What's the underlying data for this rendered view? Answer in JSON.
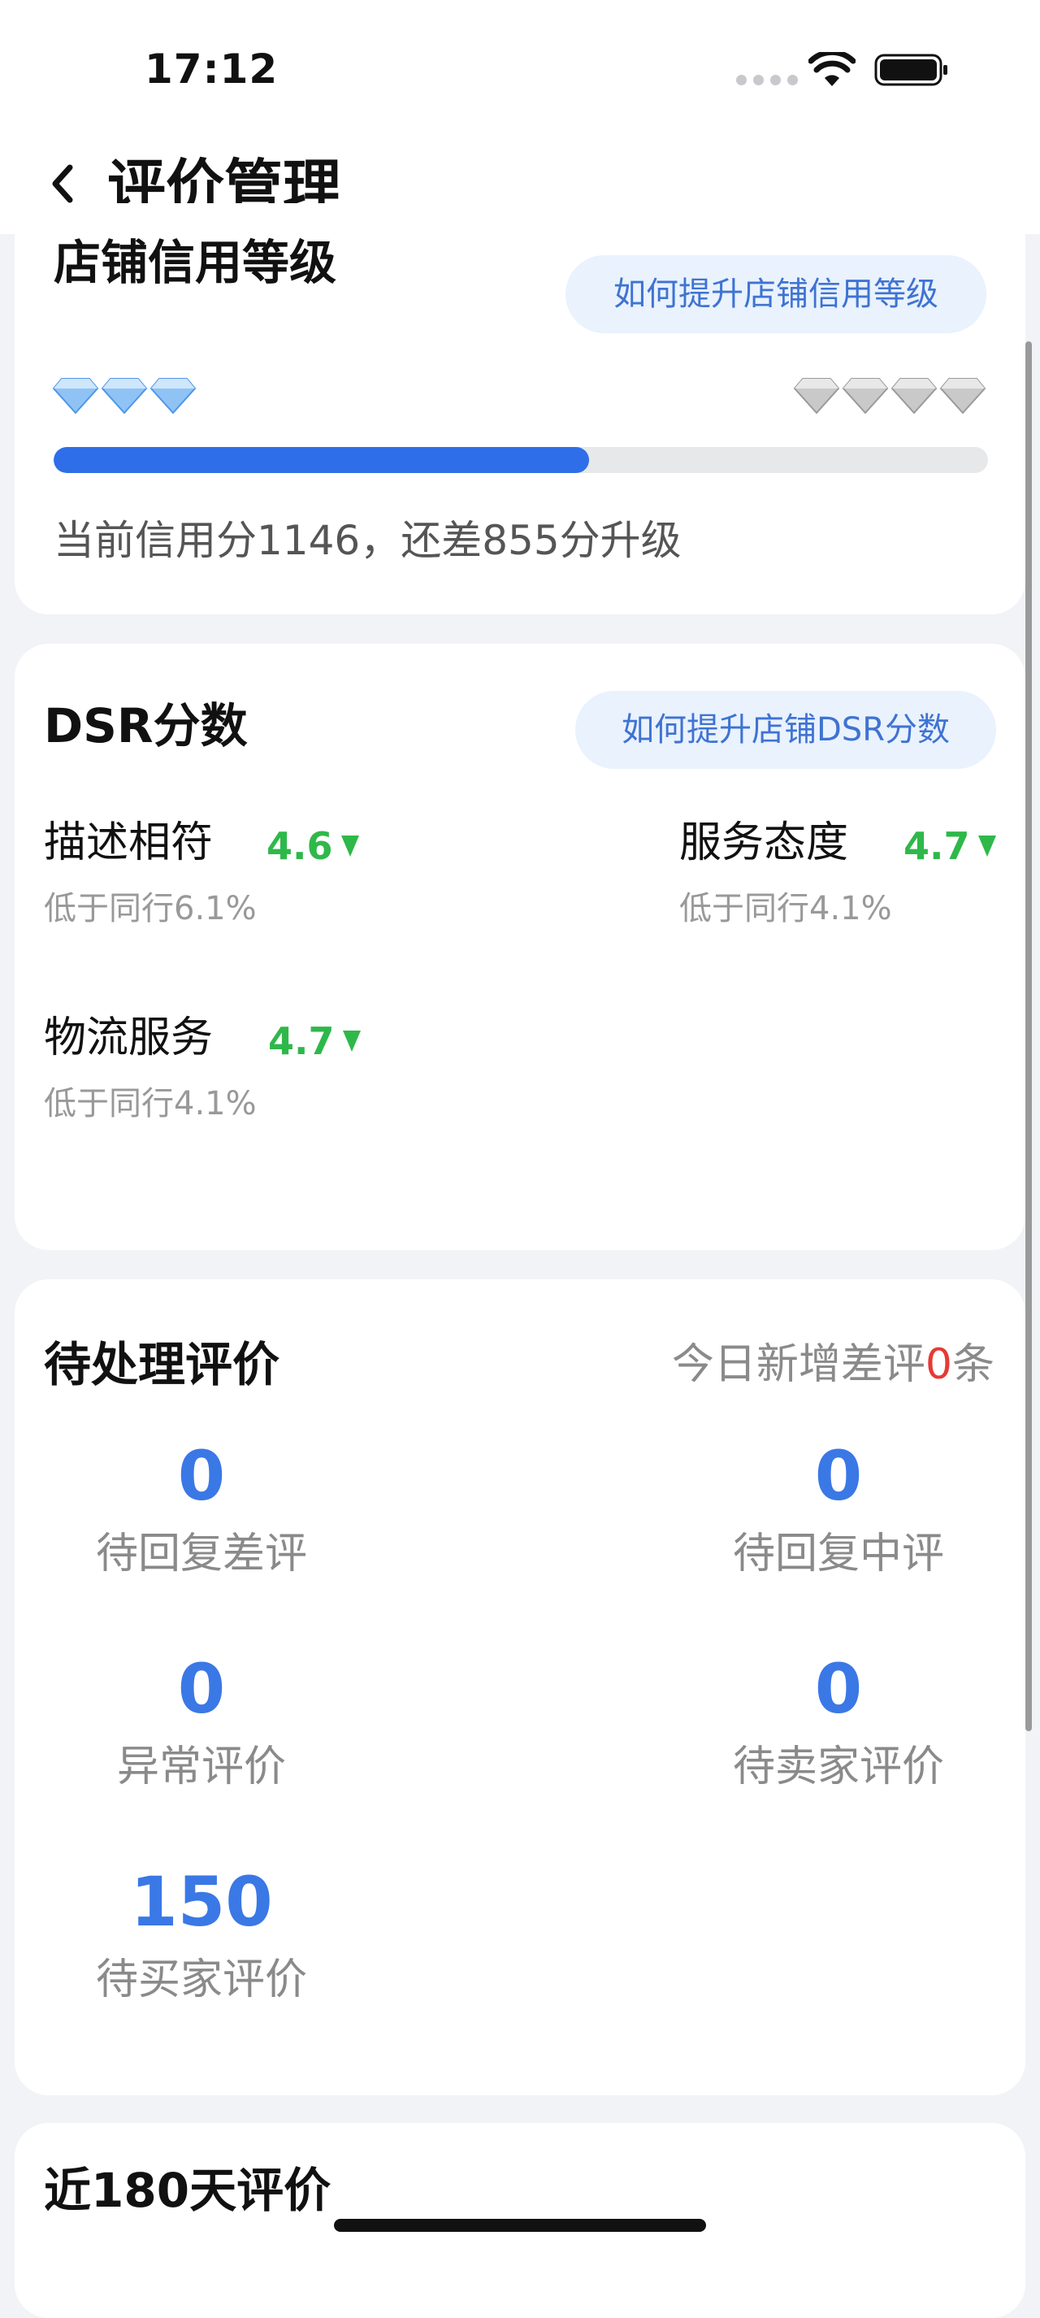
{
  "status_bar": {
    "time": "17:12"
  },
  "header": {
    "title": "评价管理"
  },
  "credit": {
    "title": "店铺信用等级",
    "help_button": "如何提升店铺信用等级",
    "current_gems": 3,
    "target_gems": 4,
    "progress": 0.573,
    "status_text": "当前信用分1146，还差855分升级",
    "colors": {
      "fill": "#2e6ee8",
      "track": "#e7e8ea"
    }
  },
  "dsr": {
    "title": "DSR分数",
    "help_button": "如何提升店铺DSR分数",
    "metrics": [
      {
        "name": "描述相符",
        "score": "4.6",
        "compare": "低于同行6.1%"
      },
      {
        "name": "服务态度",
        "score": "4.7",
        "compare": "低于同行4.1%"
      },
      {
        "name": "物流服务",
        "score": "4.7",
        "compare": "低于同行4.1%"
      }
    ],
    "colors": {
      "score": "#2fb84a"
    }
  },
  "pending": {
    "title": "待处理评价",
    "today_prefix": "今日新增差评",
    "today_count": "0",
    "today_suffix": "条",
    "stats": [
      {
        "value": "0",
        "label": "待回复差评"
      },
      {
        "value": "0",
        "label": "待回复中评"
      },
      {
        "value": "0",
        "label": "异常评价"
      },
      {
        "value": "0",
        "label": "待卖家评价"
      },
      {
        "value": "150",
        "label": "待买家评价"
      }
    ],
    "colors": {
      "value": "#3a78e6",
      "highlight": "#e63a35"
    }
  },
  "recent": {
    "title": "近180天评价"
  }
}
